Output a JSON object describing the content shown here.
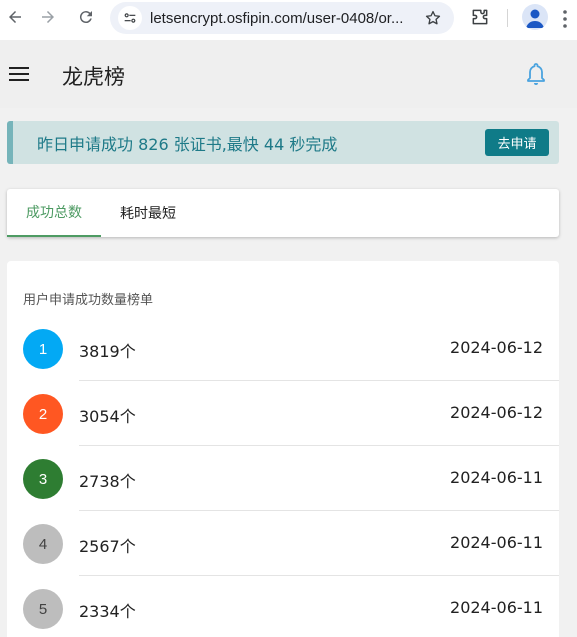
{
  "browser": {
    "url": "letsencrypt.osfipin.com/user-0408/or...",
    "icons": [
      "back-icon",
      "forward-icon",
      "reload-icon",
      "site-info-icon",
      "star-icon",
      "extensions-icon",
      "profile-icon",
      "kebab-menu-icon"
    ]
  },
  "appbar": {
    "title": "龙虎榜",
    "icons": [
      "menu-icon",
      "bell-icon"
    ],
    "accent": "#4aa3df"
  },
  "banner": {
    "text": "昨日申请成功 826 张证书,最快 44 秒完成",
    "button_label": "去申请",
    "text_color": "#1e7a88",
    "button_color": "#0f7b88"
  },
  "tabs": [
    {
      "label": "成功总数",
      "active": true
    },
    {
      "label": "耗时最短",
      "active": false
    }
  ],
  "ranking": {
    "subheader": "用户申请成功数量榜单",
    "rows": [
      {
        "rank": "1",
        "count": "3819个",
        "date": "2024-06-12",
        "color": "#03a9f4"
      },
      {
        "rank": "2",
        "count": "3054个",
        "date": "2024-06-12",
        "color": "#ff5722"
      },
      {
        "rank": "3",
        "count": "2738个",
        "date": "2024-06-11",
        "color": "#2e7d32"
      },
      {
        "rank": "4",
        "count": "2567个",
        "date": "2024-06-11",
        "color": "#bdbdbd"
      },
      {
        "rank": "5",
        "count": "2334个",
        "date": "2024-06-11",
        "color": "#bdbdbd"
      }
    ]
  }
}
